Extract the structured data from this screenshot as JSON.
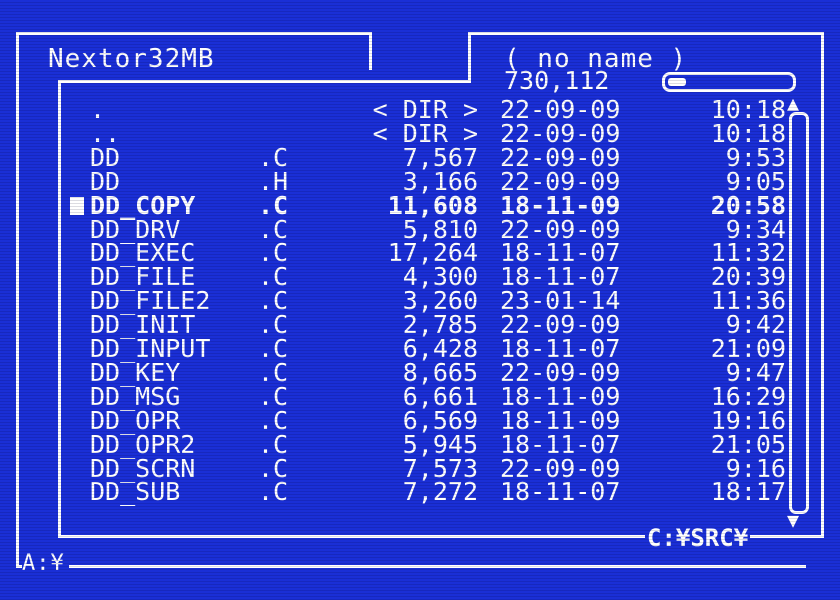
{
  "left_panel": {
    "drive_name": "Nextor32MB",
    "path": "A:¥"
  },
  "right_panel": {
    "volume_name": "( no name )",
    "free_space": "730,112",
    "usage_fraction": 0.15,
    "path": "C:¥SRC¥"
  },
  "files": [
    {
      "name": ".",
      "ext": "",
      "size": "< DIR >",
      "date": "22-09-09",
      "time": "10:18",
      "selected": false
    },
    {
      "name": "..",
      "ext": "",
      "size": "< DIR >",
      "date": "22-09-09",
      "time": "10:18",
      "selected": false
    },
    {
      "name": "DD",
      "ext": ".C",
      "size": "7,567",
      "date": "22-09-09",
      "time": "9:53",
      "selected": false
    },
    {
      "name": "DD",
      "ext": ".H",
      "size": "3,166",
      "date": "22-09-09",
      "time": "9:05",
      "selected": false
    },
    {
      "name": "DD_COPY",
      "ext": ".C",
      "size": "11,608",
      "date": "18-11-09",
      "time": "20:58",
      "selected": true
    },
    {
      "name": "DD_DRV",
      "ext": ".C",
      "size": "5,810",
      "date": "22-09-09",
      "time": "9:34",
      "selected": false
    },
    {
      "name": "DD_EXEC",
      "ext": ".C",
      "size": "17,264",
      "date": "18-11-07",
      "time": "11:32",
      "selected": false
    },
    {
      "name": "DD_FILE",
      "ext": ".C",
      "size": "4,300",
      "date": "18-11-07",
      "time": "20:39",
      "selected": false
    },
    {
      "name": "DD_FILE2",
      "ext": ".C",
      "size": "3,260",
      "date": "23-01-14",
      "time": "11:36",
      "selected": false
    },
    {
      "name": "DD_INIT",
      "ext": ".C",
      "size": "2,785",
      "date": "22-09-09",
      "time": "9:42",
      "selected": false
    },
    {
      "name": "DD_INPUT",
      "ext": ".C",
      "size": "6,428",
      "date": "18-11-07",
      "time": "21:09",
      "selected": false
    },
    {
      "name": "DD_KEY",
      "ext": ".C",
      "size": "8,665",
      "date": "22-09-09",
      "time": "9:47",
      "selected": false
    },
    {
      "name": "DD_MSG",
      "ext": ".C",
      "size": "6,661",
      "date": "18-11-09",
      "time": "16:29",
      "selected": false
    },
    {
      "name": "DD_OPR",
      "ext": ".C",
      "size": "6,569",
      "date": "18-11-09",
      "time": "19:16",
      "selected": false
    },
    {
      "name": "DD_OPR2",
      "ext": ".C",
      "size": "5,945",
      "date": "18-11-07",
      "time": "21:05",
      "selected": false
    },
    {
      "name": "DD_SCRN",
      "ext": ".C",
      "size": "7,573",
      "date": "22-09-09",
      "time": "9:16",
      "selected": false
    },
    {
      "name": "DD_SUB",
      "ext": ".C",
      "size": "7,272",
      "date": "18-11-07",
      "time": "18:17",
      "selected": false
    }
  ],
  "scrollbar": {
    "up_arrow": "▲",
    "down_arrow": "▼",
    "position_fraction": 0.0
  },
  "colors": {
    "background": "#1a2fd6",
    "foreground": "#ffffff"
  }
}
